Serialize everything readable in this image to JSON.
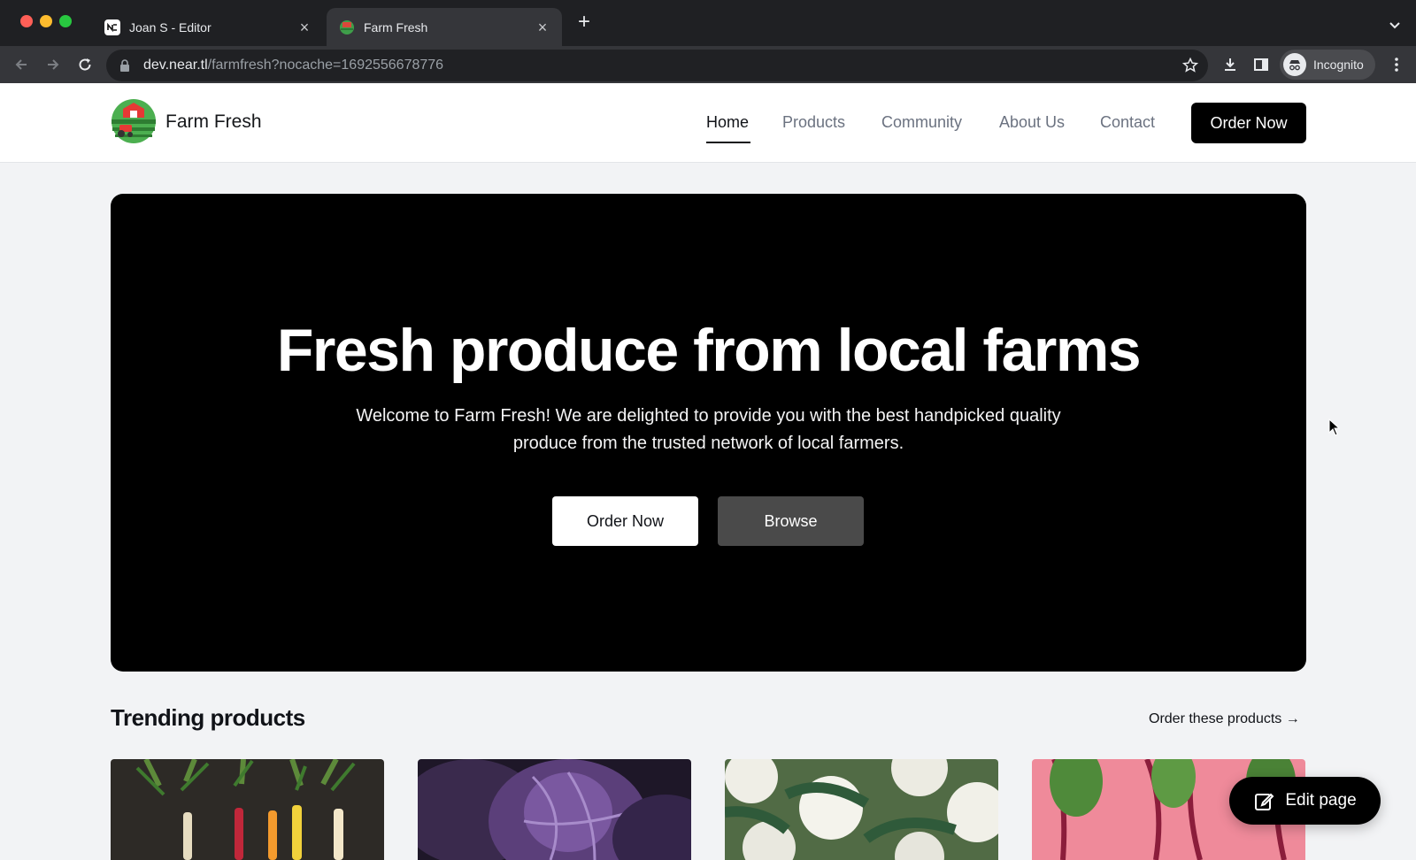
{
  "browser": {
    "tabs": [
      {
        "title": "Joan S - Editor",
        "active": false
      },
      {
        "title": "Farm Fresh",
        "active": true
      }
    ],
    "url_host": "dev.near.tl",
    "url_path": "/farmfresh?nocache=1692556678776",
    "profile_label": "Incognito"
  },
  "site": {
    "brand": "Farm Fresh",
    "nav": [
      {
        "label": "Home",
        "active": true
      },
      {
        "label": "Products",
        "active": false
      },
      {
        "label": "Community",
        "active": false
      },
      {
        "label": "About Us",
        "active": false
      },
      {
        "label": "Contact",
        "active": false
      }
    ],
    "header_cta": "Order Now"
  },
  "hero": {
    "title": "Fresh produce from local farms",
    "subtitle": "Welcome to Farm Fresh! We are delighted to provide you with the best handpicked quality produce from the trusted network of local farmers.",
    "primary_button": "Order Now",
    "secondary_button": "Browse"
  },
  "trending": {
    "title": "Trending products",
    "link": "Order these products →",
    "cards": [
      {
        "image": "carrots-photo"
      },
      {
        "image": "red-cabbage-photo"
      },
      {
        "image": "cauliflower-photo"
      },
      {
        "image": "beetroot-photo"
      }
    ]
  },
  "edit_button": "Edit page",
  "colors": {
    "chrome_dark": "#1f2023",
    "chrome_bar": "#35363a",
    "hero_bg": "#000000",
    "accent": "#000000",
    "page_bg": "#f2f3f5"
  }
}
